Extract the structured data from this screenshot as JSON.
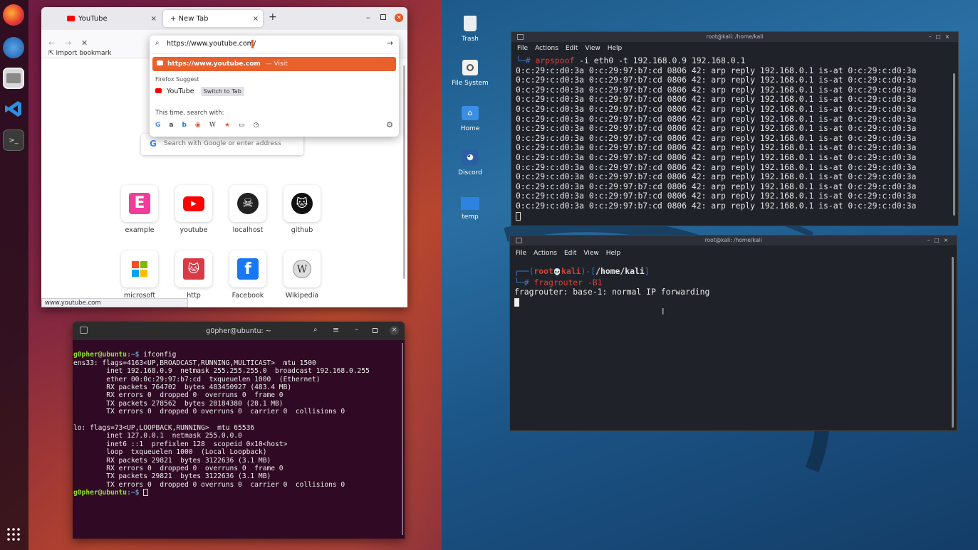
{
  "firefox": {
    "tabs": [
      {
        "label": "YouTube",
        "close": "×"
      },
      {
        "label": "+ New Tab",
        "close": "×"
      }
    ],
    "new_tab_button": "+",
    "url_value": "https://www.youtube.com/",
    "bookmark_text": "Import bookmark",
    "dropdown": {
      "highlight_url": "https://www.youtube.com",
      "highlight_action": "— Visit",
      "suggest_heading": "Firefox Suggest",
      "suggest_item": "YouTube",
      "switch_to_tab": "Switch to Tab",
      "search_with": "This time, search with:"
    },
    "search_placeholder": "Search with Google or enter address",
    "shortcuts": [
      "example",
      "youtube",
      "localhost",
      "github",
      "microsoft",
      "http",
      "Facebook",
      "Wikipedia"
    ],
    "status_url": "www.youtube.com"
  },
  "ubuntu_terminal": {
    "title": "g0pher@ubuntu: ~",
    "prompt_user": "g0pher@ubuntu",
    "prompt_path": ":~$",
    "command": " ifconfig",
    "lines": [
      "ens33: flags=4163<UP,BROADCAST,RUNNING,MULTICAST>  mtu 1500",
      "        inet 192.168.0.9  netmask 255.255.255.0  broadcast 192.168.0.255",
      "        ether 00:0c:29:97:b7:cd  txqueuelen 1000  (Ethernet)",
      "        RX packets 764702  bytes 483450927 (483.4 MB)",
      "        RX errors 0  dropped 0  overruns 0  frame 0",
      "        TX packets 278562  bytes 28184380 (28.1 MB)",
      "        TX errors 0  dropped 0 overruns 0  carrier 0  collisions 0",
      "",
      "lo: flags=73<UP,LOOPBACK,RUNNING>  mtu 65536",
      "        inet 127.0.0.1  netmask 255.0.0.0",
      "        inet6 ::1  prefixlen 128  scopeid 0x10<host>",
      "        loop  txqueuelen 1000  (Local Loopback)",
      "        RX packets 29821  bytes 3122636 (3.1 MB)",
      "        RX errors 0  dropped 0  overruns 0  frame 0",
      "        TX packets 29821  bytes 3122636 (3.1 MB)",
      "        TX errors 0  dropped 0 overruns 0  carrier 0  collisions 0"
    ]
  },
  "kali_desktop": {
    "icons": [
      "Trash",
      "File System",
      "Home",
      "Discord",
      "temp"
    ]
  },
  "kali_term1": {
    "title": "root@kali: /home/kali",
    "menu": [
      "File",
      "Actions",
      "Edit",
      "View",
      "Help"
    ],
    "prompt_glyph": "└─#",
    "command": "arpspoof",
    "args": " -i eth0 -t 192.168.0.9 192.168.0.1",
    "lines": [
      "0:c:29:c:d0:3a 0:c:29:97:b7:cd 0806 42: arp reply 192.168.0.1 is-at 0:c:29:c:d0:3a",
      "0:c:29:c:d0:3a 0:c:29:97:b7:cd 0806 42: arp reply 192.168.0.1 is-at 0:c:29:c:d0:3a",
      "0:c:29:c:d0:3a 0:c:29:97:b7:cd 0806 42: arp reply 192.168.0.1 is-at 0:c:29:c:d0:3a",
      "0:c:29:c:d0:3a 0:c:29:97:b7:cd 0806 42: arp reply 192.168.0.1 is-at 0:c:29:c:d0:3a",
      "0:c:29:c:d0:3a 0:c:29:97:b7:cd 0806 42: arp reply 192.168.0.1 is-at 0:c:29:c:d0:3a",
      "0:c:29:c:d0:3a 0:c:29:97:b7:cd 0806 42: arp reply 192.168.0.1 is-at 0:c:29:c:d0:3a",
      "0:c:29:c:d0:3a 0:c:29:97:b7:cd 0806 42: arp reply 192.168.0.1 is-at 0:c:29:c:d0:3a",
      "0:c:29:c:d0:3a 0:c:29:97:b7:cd 0806 42: arp reply 192.168.0.1 is-at 0:c:29:c:d0:3a",
      "0:c:29:c:d0:3a 0:c:29:97:b7:cd 0806 42: arp reply 192.168.0.1 is-at 0:c:29:c:d0:3a",
      "0:c:29:c:d0:3a 0:c:29:97:b7:cd 0806 42: arp reply 192.168.0.1 is-at 0:c:29:c:d0:3a",
      "0:c:29:c:d0:3a 0:c:29:97:b7:cd 0806 42: arp reply 192.168.0.1 is-at 0:c:29:c:d0:3a",
      "0:c:29:c:d0:3a 0:c:29:97:b7:cd 0806 42: arp reply 192.168.0.1 is-at 0:c:29:c:d0:3a",
      "0:c:29:c:d0:3a 0:c:29:97:b7:cd 0806 42: arp reply 192.168.0.1 is-at 0:c:29:c:d0:3a",
      "0:c:29:c:d0:3a 0:c:29:97:b7:cd 0806 42: arp reply 192.168.0.1 is-at 0:c:29:c:d0:3a",
      "0:c:29:c:d0:3a 0:c:29:97:b7:cd 0806 42: arp reply 192.168.0.1 is-at 0:c:29:c:d0:3a"
    ]
  },
  "kali_term2": {
    "title": "root@kali: /home/kali",
    "menu": [
      "File",
      "Actions",
      "Edit",
      "View",
      "Help"
    ],
    "prompt_open": "┌──(",
    "prompt_user": "root",
    "prompt_skull": "💀",
    "prompt_host": "kali",
    "prompt_mid": ")-[",
    "prompt_path": "/home/kali",
    "prompt_close": "]",
    "prompt_glyph": "└─#",
    "command": "fragrouter",
    "args": " -B1",
    "output": "fragrouter: base-1: normal IP forwarding"
  },
  "colors": {
    "ubuntu_terminal_bg": "#300a24",
    "prompt_green": "#8ae234",
    "kali_red": "#d6433a",
    "firefox_highlight": "#e8602c"
  }
}
